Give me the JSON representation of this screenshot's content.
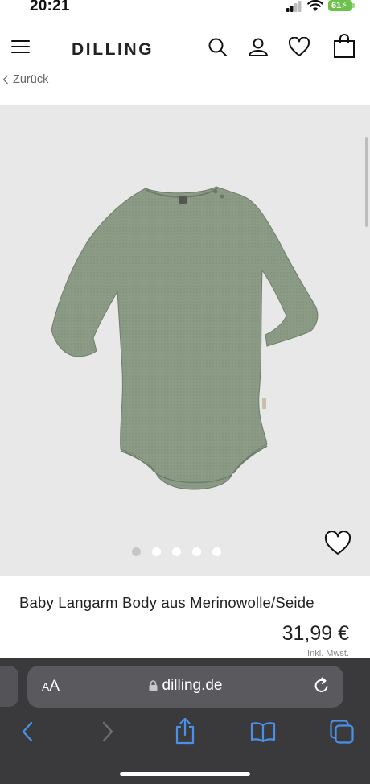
{
  "status_bar": {
    "time": "20:21",
    "battery": "61"
  },
  "header": {
    "brand": "DILLING",
    "back_label": "Zurück",
    "icons": [
      "menu-icon",
      "search-icon",
      "account-icon",
      "wishlist-heart-icon",
      "shopping-bag-icon"
    ]
  },
  "gallery": {
    "image_alt": "Baby Langarm Body aus Merinowolle/Seide",
    "slide_count": 5,
    "active_slide": 1
  },
  "product": {
    "title": "Baby Langarm Body aus Merinowolle/Seide",
    "price": "31,99 €",
    "tax_note": "Inkl. Mwst."
  },
  "browser": {
    "text_size_label": "AA",
    "url": "dilling.de"
  },
  "colors": {
    "garment": "#8a9a84",
    "hero_background": "#e8e8e8",
    "browser_bar": "#3a3a3c",
    "toolbar_accent": "#4a90e8"
  }
}
